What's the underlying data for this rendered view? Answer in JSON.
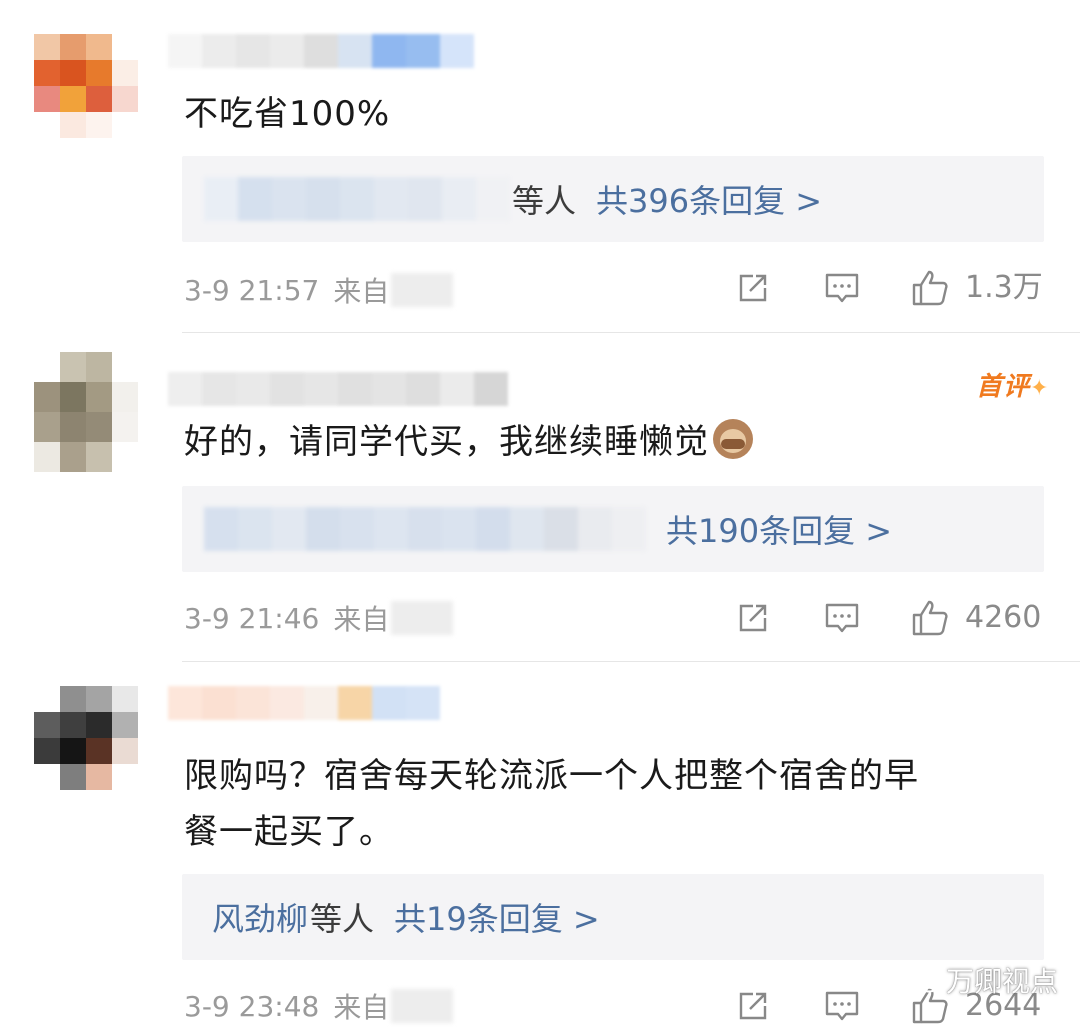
{
  "comments": [
    {
      "text": "不吃省100%",
      "reply_others": "等人",
      "reply_link": "共396条回复 >",
      "time": "3-9 21:57",
      "source_prefix": "来自",
      "likes": "1.3万"
    },
    {
      "badge": "首评",
      "text": "好的，请同学代买，我继续睡懒觉",
      "emoji": "see-no-evil-monkey",
      "reply_link": "共190条回复 >",
      "time": "3-9 21:46",
      "source_prefix": "来自",
      "likes": "4260"
    },
    {
      "text_line1": "限购吗？宿舍每天轮流派一个人把整个宿舍的早",
      "text_line2": "餐一起买了。",
      "reply_name": "风劲柳",
      "reply_others": "等人",
      "reply_link": "共19条回复 >",
      "time": "3-9 23:48",
      "source_prefix": "来自",
      "likes": "2644"
    }
  ],
  "icons": [
    "share-icon",
    "comment-icon",
    "like-icon"
  ],
  "watermark": "万卿视点",
  "colors": {
    "link": "#4b6f9f",
    "badge": "#f07a1f",
    "reply_bg": "#f4f4f6",
    "meta": "#9a9a9a"
  }
}
